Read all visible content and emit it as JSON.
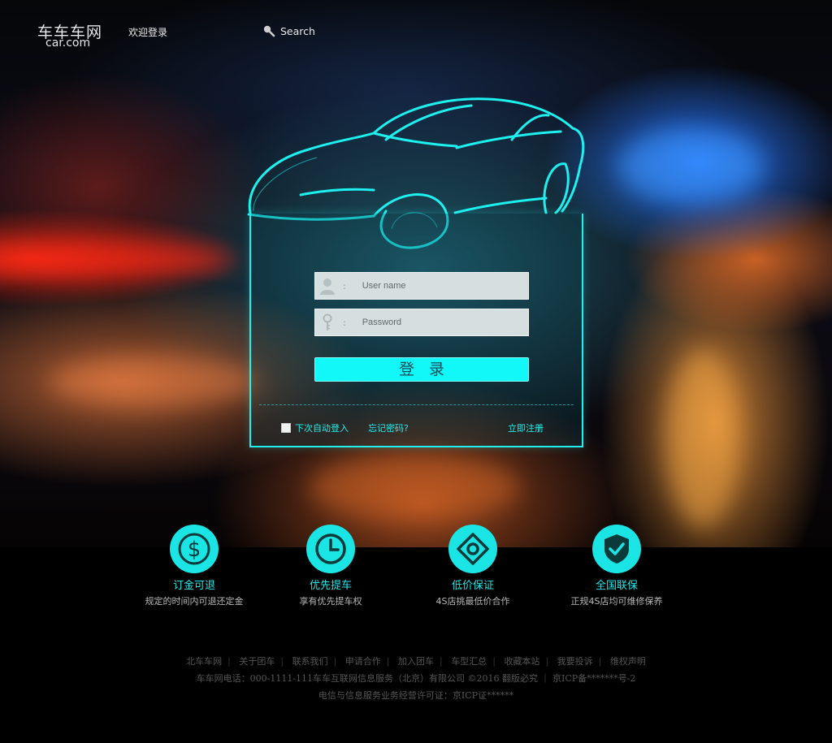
{
  "header": {
    "logo_cn": "车车车网",
    "logo_en": "car.com",
    "welcome": "欢迎登录",
    "search_label": "Search"
  },
  "login": {
    "username_placeholder": "User name",
    "password_placeholder": "Password",
    "field_separator": ":",
    "submit_label": "登录",
    "remember_label": "下次自动登入",
    "forgot_label": "忘记密码?",
    "register_label": "立即注册"
  },
  "features": [
    {
      "title": "订金可退",
      "desc": "规定的时间内可退还定金",
      "icon": "dollar-icon"
    },
    {
      "title": "优先提车",
      "desc": "享有优先提车权",
      "icon": "clock-icon"
    },
    {
      "title": "低价保证",
      "desc": "4S店挑最低价合作",
      "icon": "diamond-icon"
    },
    {
      "title": "全国联保",
      "desc": "正规4S店均可维修保养",
      "icon": "shield-check-icon"
    }
  ],
  "footer": {
    "links": [
      "北车车网",
      "关于团车",
      "联系我们",
      "申请合作",
      "加入团车",
      "车型汇总",
      "收藏本站",
      "我要投诉",
      "维权声明"
    ],
    "line2": "车车网电话：000-1111-111车车互联网信息服务（北京）有限公司 ©2016  翻版必究  ｜  京ICP备*******号-2",
    "line3": "电信与信息服务业务经营许可证：京ICP证******"
  },
  "colors": {
    "accent": "#1ef0f0",
    "button": "#12f7f7",
    "background": "#000000"
  }
}
